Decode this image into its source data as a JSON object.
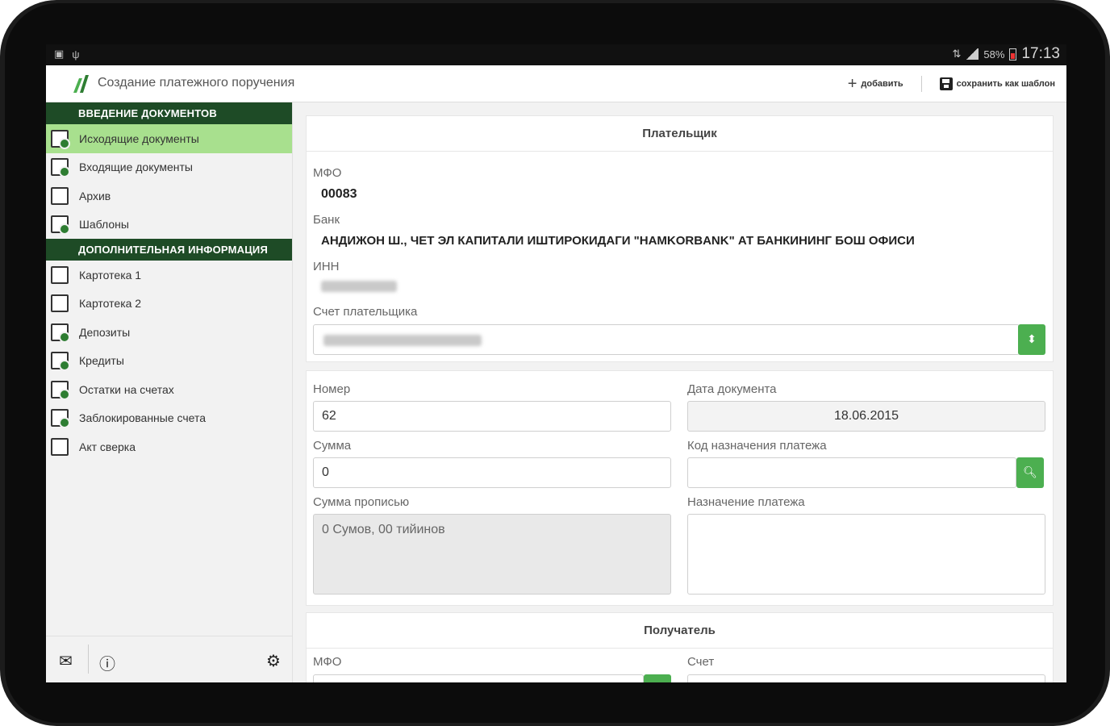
{
  "status_bar": {
    "battery": "58%",
    "time": "17:13"
  },
  "app_bar": {
    "title": "Создание платежного поручения",
    "add_label": "добавить",
    "save_template_label": "сохранить как шаблон"
  },
  "sidebar": {
    "section1": "ВВЕДЕНИЕ ДОКУМЕНТОВ",
    "items1": [
      {
        "label": "Исходящие документы",
        "icon": "outgoing-docs-icon"
      },
      {
        "label": "Входящие документы",
        "icon": "incoming-docs-icon"
      },
      {
        "label": "Архив",
        "icon": "archive-icon"
      },
      {
        "label": "Шаблоны",
        "icon": "templates-icon"
      }
    ],
    "section2": "ДОПОЛНИТЕЛЬНАЯ ИНФОРМАЦИЯ",
    "items2": [
      {
        "label": "Картотека 1",
        "icon": "card-file-icon"
      },
      {
        "label": "Картотека 2",
        "icon": "card-file-icon"
      },
      {
        "label": "Депозиты",
        "icon": "deposits-icon"
      },
      {
        "label": "Кредиты",
        "icon": "credits-icon"
      },
      {
        "label": "Остатки на счетах",
        "icon": "balances-icon"
      },
      {
        "label": "Заблокированные счета",
        "icon": "blocked-accounts-icon"
      },
      {
        "label": "Акт сверка",
        "icon": "scales-icon"
      }
    ]
  },
  "payer": {
    "title": "Плательщик",
    "mfo_label": "МФО",
    "mfo_value": "00083",
    "bank_label": "Банк",
    "bank_value": "АНДИЖОН Ш., ЧЕТ ЭЛ КАПИТАЛИ ИШТИРОКИДАГИ \"HAMKORBANK\" АТ БАНКИНИНГ БОШ ОФИСИ",
    "inn_label": "ИНН",
    "account_label": "Счет плательщика"
  },
  "document": {
    "number_label": "Номер",
    "number_value": "62",
    "date_label": "Дата документа",
    "date_value": "18.06.2015",
    "sum_label": "Сумма",
    "sum_value": "0",
    "purpose_code_label": "Код назначения платежа",
    "sum_words_label": "Сумма прописью",
    "sum_words_value": "0 Сумов, 00 тийинов",
    "purpose_label": "Назначение платежа"
  },
  "recipient": {
    "title": "Получатель",
    "mfo_label": "МФО",
    "account_label": "Счет"
  },
  "colors": {
    "accent": "#4caf50",
    "dark_green": "#1e4b26",
    "active_item": "#a8e08e"
  }
}
